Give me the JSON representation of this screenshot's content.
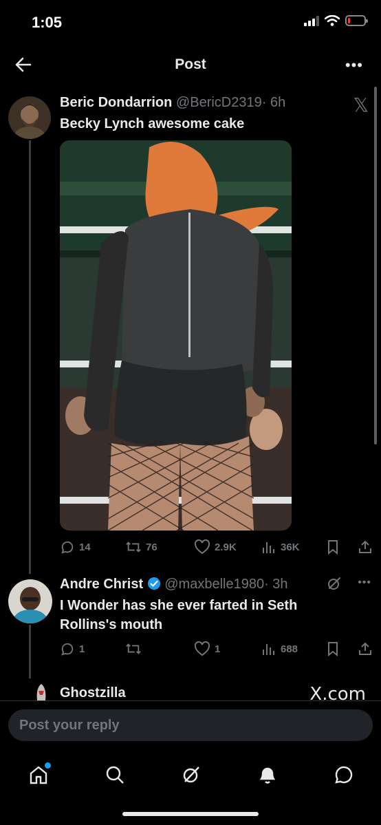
{
  "status_bar": {
    "time": "1:05",
    "battery_level": 0.15
  },
  "nav": {
    "title": "Post",
    "more": "•••"
  },
  "tweets": [
    {
      "name": "Beric Dondarrion",
      "handle": "@BericD2319",
      "time": "· 6h",
      "text": "Becky Lynch awesome cake",
      "counts": {
        "reply": "14",
        "retweet": "76",
        "like": "2.9K",
        "views": "36K"
      }
    },
    {
      "name": "Andre Christ",
      "handle": "@maxbelle1980",
      "time": "· 3h",
      "text": "I Wonder has she ever farted in Seth Rollins's mouth",
      "counts": {
        "reply": "1",
        "retweet": "",
        "like": "1",
        "views": "688"
      }
    },
    {
      "name": "Ghostzilla"
    }
  ],
  "watermark": "X.com",
  "reply": {
    "placeholder": "Post your reply"
  },
  "icons": {
    "back": "arrow-left-icon",
    "more": "more-horizontal-icon",
    "x_logo": "x-logo-icon",
    "reply": "comment-icon",
    "retweet": "retweet-icon",
    "like": "heart-icon",
    "views": "bar-chart-icon",
    "bookmark": "bookmark-icon",
    "share": "share-icon",
    "verified": "verified-badge-icon",
    "grok": "grok-icon",
    "tabs": [
      "home-icon",
      "search-icon",
      "grok-icon",
      "bell-icon",
      "chat-icon"
    ]
  },
  "colors": {
    "background": "#000000",
    "text": "#e7e9ea",
    "muted": "#71767b",
    "accent": "#1d9bf0"
  }
}
